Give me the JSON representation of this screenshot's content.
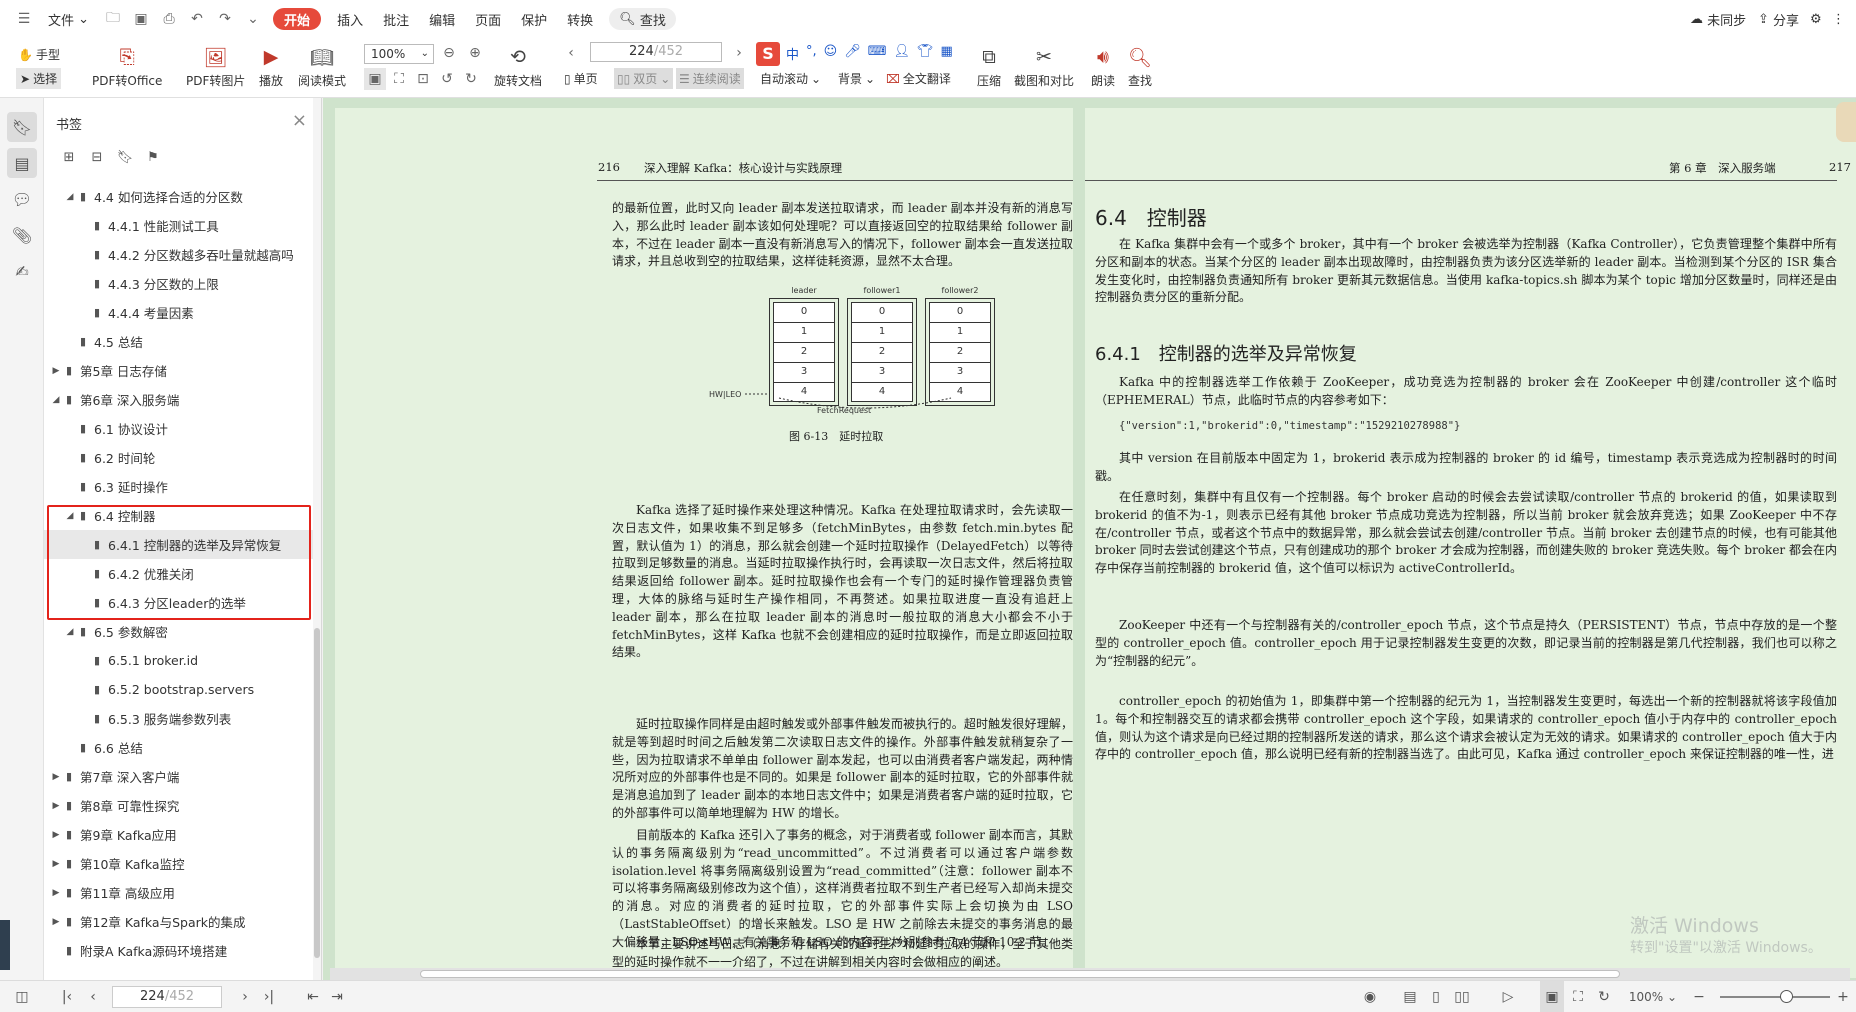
{
  "menubar": {
    "file": "文件",
    "menus": [
      "开始",
      "插入",
      "批注",
      "编辑",
      "页面",
      "保护",
      "转换"
    ],
    "search": "查找",
    "sync": "未同步",
    "share": "分享"
  },
  "toolbar": {
    "hand": "手型",
    "select": "选择",
    "pdf_to_office": "PDF转Office",
    "pdf_to_image": "PDF转图片",
    "play": "播放",
    "read_mode": "阅读模式",
    "zoom": "100%",
    "rotate": "旋转文档",
    "page_input": "224",
    "page_total": "/452",
    "single": "单页",
    "double": "双页",
    "continuous": "连续阅读",
    "auto_scroll": "自动滚动",
    "background": "背景",
    "full_translate": "全文翻译",
    "compress": "压缩",
    "screenshot_compare": "截图和对比",
    "read_aloud": "朗读",
    "find": "查找",
    "ime": "中"
  },
  "sidebar": {
    "title": "书签",
    "items": [
      {
        "label": "4.4 如何选择合适的分区数",
        "level": 1,
        "arrow": "◢"
      },
      {
        "label": "4.4.1 性能测试工具",
        "level": 2,
        "arrow": ""
      },
      {
        "label": "4.4.2 分区数越多吞吐量就越高吗",
        "level": 2,
        "arrow": ""
      },
      {
        "label": "4.4.3 分区数的上限",
        "level": 2,
        "arrow": ""
      },
      {
        "label": "4.4.4 考量因素",
        "level": 2,
        "arrow": ""
      },
      {
        "label": "4.5 总结",
        "level": 1,
        "arrow": ""
      },
      {
        "label": "第5章 日志存储",
        "level": 0,
        "arrow": "▶"
      },
      {
        "label": "第6章 深入服务端",
        "level": 0,
        "arrow": "◢"
      },
      {
        "label": "6.1 协议设计",
        "level": 1,
        "arrow": ""
      },
      {
        "label": "6.2 时间轮",
        "level": 1,
        "arrow": ""
      },
      {
        "label": "6.3 延时操作",
        "level": 1,
        "arrow": ""
      },
      {
        "label": "6.4 控制器",
        "level": 1,
        "arrow": "◢"
      },
      {
        "label": "6.4.1 控制器的选举及异常恢复",
        "level": 2,
        "arrow": "",
        "selected": true
      },
      {
        "label": "6.4.2 优雅关闭",
        "level": 2,
        "arrow": ""
      },
      {
        "label": "6.4.3 分区leader的选举",
        "level": 2,
        "arrow": ""
      },
      {
        "label": "6.5 参数解密",
        "level": 1,
        "arrow": "◢"
      },
      {
        "label": "6.5.1 broker.id",
        "level": 2,
        "arrow": ""
      },
      {
        "label": "6.5.2 bootstrap.servers",
        "level": 2,
        "arrow": ""
      },
      {
        "label": "6.5.3 服务端参数列表",
        "level": 2,
        "arrow": ""
      },
      {
        "label": "6.6 总结",
        "level": 1,
        "arrow": ""
      },
      {
        "label": "第7章 深入客户端",
        "level": 0,
        "arrow": "▶"
      },
      {
        "label": "第8章 可靠性探究",
        "level": 0,
        "arrow": "▶"
      },
      {
        "label": "第9章 Kafka应用",
        "level": 0,
        "arrow": "▶"
      },
      {
        "label": "第10章 Kafka监控",
        "level": 0,
        "arrow": "▶"
      },
      {
        "label": "第11章 高级应用",
        "level": 0,
        "arrow": "▶"
      },
      {
        "label": "第12章 Kafka与Spark的集成",
        "level": 0,
        "arrow": "▶"
      },
      {
        "label": "附录A Kafka源码环境搭建",
        "level": 0,
        "arrow": ""
      }
    ]
  },
  "left_page": {
    "page_no": "216",
    "header": "深入理解 Kafka：核心设计与实践原理",
    "p1": "的最新位置，此时又向 leader 副本发送拉取请求，而 leader 副本并没有新的消息写入，那么此时 leader 副本该如何处理呢？可以直接返回空的拉取结果给 follower 副本，不过在 leader 副本一直没有新消息写入的情况下，follower 副本会一直发送拉取请求，并且总收到空的拉取结果，这样徒耗资源，显然不太合理。",
    "figure": {
      "cols": [
        "leader",
        "follower1",
        "follower2"
      ],
      "cells": [
        "0",
        "1",
        "2",
        "3",
        "4"
      ],
      "hw_label": "HW|LEO",
      "fetch_label": "FetchRequest",
      "caption": "图 6-13　延时拉取"
    },
    "p2": "Kafka 选择了延时操作来处理这种情况。Kafka 在处理拉取请求时，会先读取一次日志文件，如果收集不到足够多（fetchMinBytes，由参数 fetch.min.bytes 配置，默认值为 1）的消息，那么就会创建一个延时拉取操作（DelayedFetch）以等待拉取到足够数量的消息。当延时拉取操作执行时，会再读取一次日志文件，然后将拉取结果返回给 follower 副本。延时拉取操作也会有一个专门的延时操作管理器负责管理，大体的脉络与延时生产操作相同，不再赘述。如果拉取进度一直没有追赶上 leader 副本，那么在拉取 leader 副本的消息时一般拉取的消息大小都会不小于 fetchMinBytes，这样 Kafka 也就不会创建相应的延时拉取操作，而是立即返回拉取结果。",
    "p3": "延时拉取操作同样是由超时触发或外部事件触发而被执行的。超时触发很好理解，就是等到超时时间之后触发第二次读取日志文件的操作。外部事件触发就稍复杂了一些，因为拉取请求不单单由 follower 副本发起，也可以由消费者客户端发起，两种情况所对应的外部事件也是不同的。如果是 follower 副本的延时拉取，它的外部事件就是消息追加到了 leader 副本的本地日志文件中；如果是消费者客户端的延时拉取，它的外部事件可以简单地理解为 HW 的增长。",
    "p4": "目前版本的 Kafka 还引入了事务的概念，对于消费者或 follower 副本而言，其默认的事务隔离级别为“read_uncommitted”。不过消费者可以通过客户端参数 isolation.level 将事务隔离级别设置为“read_committed”（注意：follower 副本不可以将事务隔离级别修改为这个值），这样消费者拉取不到生产者已经写入却尚未提交的消息。对应的消费者的延时拉取，它的外部事件实际上会切换为由 LSO（LastStableOffset）的增长来触发。LSO 是 HW 之前除去未提交的事务消息的最大偏移量，LSO≤HW，有关事务和 LSO 的内容可以分别参考 7.4 节和 10.2 节。",
    "p5": "本节主要讲述与日志（消息）存储有关的延时生产和延时拉取的操作，至于其他类型的延时操作就不一一介绍了，不过在讲解到相关内容时会做相应的阐述。"
  },
  "right_page": {
    "chapter": "第 6 章　深入服务端",
    "page_no": "217",
    "h1": "6.4　控制器",
    "p1": "在 Kafka 集群中会有一个或多个 broker，其中有一个 broker 会被选举为控制器（Kafka Controller），它负责管理整个集群中所有分区和副本的状态。当某个分区的 leader 副本出现故障时，由控制器负责为该分区选举新的 leader 副本。当检测到某个分区的 ISR 集合发生变化时，由控制器负责通知所有 broker 更新其元数据信息。当使用 kafka-topics.sh 脚本为某个 topic 增加分区数量时，同样还是由控制器负责分区的重新分配。",
    "h2": "6.4.1　控制器的选举及异常恢复",
    "p2": "Kafka 中的控制器选举工作依赖于 ZooKeeper，成功竞选为控制器的 broker 会在 ZooKeeper 中创建/controller 这个临时（EPHEMERAL）节点，此临时节点的内容参考如下：",
    "code": "{\"version\":1,\"brokerid\":0,\"timestamp\":\"1529210278988\"}",
    "p3": "其中 version 在目前版本中固定为 1，brokerid 表示成为控制器的 broker 的 id 编号，timestamp 表示竞选成为控制器时的时间戳。",
    "p4": "在任意时刻，集群中有且仅有一个控制器。每个 broker 启动的时候会去尝试读取/controller 节点的 brokerid 的值，如果读取到 brokerid 的值不为-1，则表示已经有其他 broker 节点成功竞选为控制器，所以当前 broker 就会放弃竞选；如果 ZooKeeper 中不存在/controller 节点，或者这个节点中的数据异常，那么就会尝试去创建/controller 节点。当前 broker 去创建节点的时候，也有可能其他 broker 同时去尝试创建这个节点，只有创建成功的那个 broker 才会成为控制器，而创建失败的 broker 竞选失败。每个 broker 都会在内存中保存当前控制器的 brokerid 值，这个值可以标识为 activeControllerId。",
    "p5": "ZooKeeper 中还有一个与控制器有关的/controller_epoch 节点，这个节点是持久（PERSISTENT）节点，节点中存放的是一个整型的 controller_epoch 值。controller_epoch 用于记录控制器发生变更的次数，即记录当前的控制器是第几代控制器，我们也可以称之为“控制器的纪元”。",
    "p6": "controller_epoch 的初始值为 1，即集群中第一个控制器的纪元为 1，当控制器发生变更时，每选出一个新的控制器就将该字段值加 1。每个和控制器交互的请求都会携带 controller_epoch 这个字段，如果请求的 controller_epoch 值小于内存中的 controller_epoch 值，则认为这个请求是向已经过期的控制器所发送的请求，那么这个请求会被认定为无效的请求。如果请求的 controller_epoch 值大于内存中的 controller_epoch 值，那么说明已经有新的控制器当选了。由此可见，Kafka 通过 controller_epoch 来保证控制器的唯一性，进"
  },
  "watermark": {
    "line1": "激活 Windows",
    "line2": "转到\"设置\"以激活 Windows。"
  },
  "statusbar": {
    "page_input": "224",
    "page_total": "/452",
    "zoom": "100%"
  }
}
